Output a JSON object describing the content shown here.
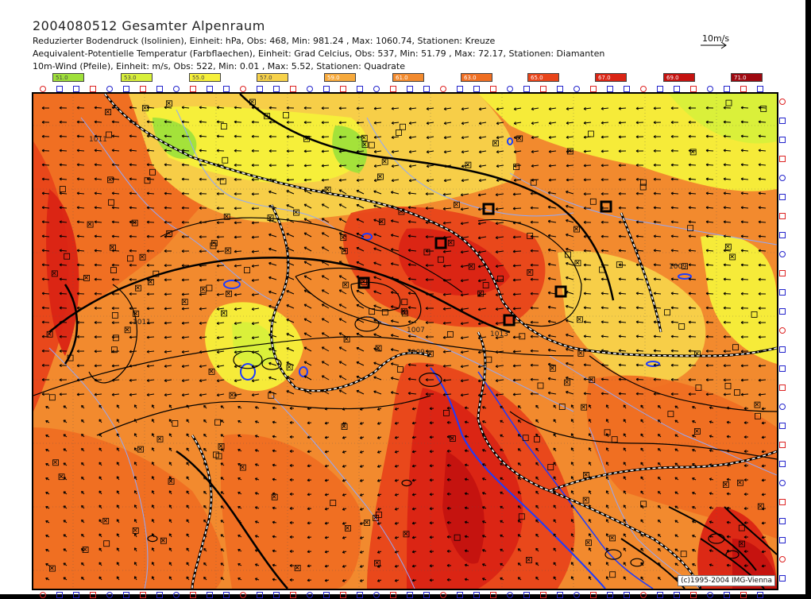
{
  "header": {
    "title": "2004080512 Gesamter Alpenraum",
    "line1": "Reduzierter Bodendruck (Isolinien), Einheit: hPa, Obs:  468, Min:  981.24 , Max: 1060.74, Stationen: Kreuze",
    "line2": "Aequivalent-Potentielle Temperatur (Farbflaechen), Einheit: Grad Celcius, Obs:  537, Min:  51.79 , Max:  72.17, Stationen: Diamanten",
    "line3": "10m-Wind (Pfeile), Einheit: m/s, Obs:  522, Min:   0.01 , Max:   5.52, Stationen: Quadrate",
    "wind_scale": "10m/s"
  },
  "legend": [
    {
      "label": "51.0",
      "color": "#9fe03a"
    },
    {
      "label": "53.0",
      "color": "#d8f03a"
    },
    {
      "label": "55.0",
      "color": "#f6f03a"
    },
    {
      "label": "57.0",
      "color": "#f7d24a"
    },
    {
      "label": "59.0",
      "color": "#f6a93c"
    },
    {
      "label": "61.0",
      "color": "#f28a2e"
    },
    {
      "label": "63.0",
      "color": "#ef6e22"
    },
    {
      "label": "65.0",
      "color": "#e8441a"
    },
    {
      "label": "67.0",
      "color": "#da2414"
    },
    {
      "label": "69.0",
      "color": "#c4120f"
    },
    {
      "label": "71.0",
      "color": "#9e0810"
    }
  ],
  "isobar_labels": [
    "1007",
    "1009",
    "1011",
    "1013",
    "1011",
    "1009"
  ],
  "copyright": "(c)1995-2004 IMG-Vienna"
}
